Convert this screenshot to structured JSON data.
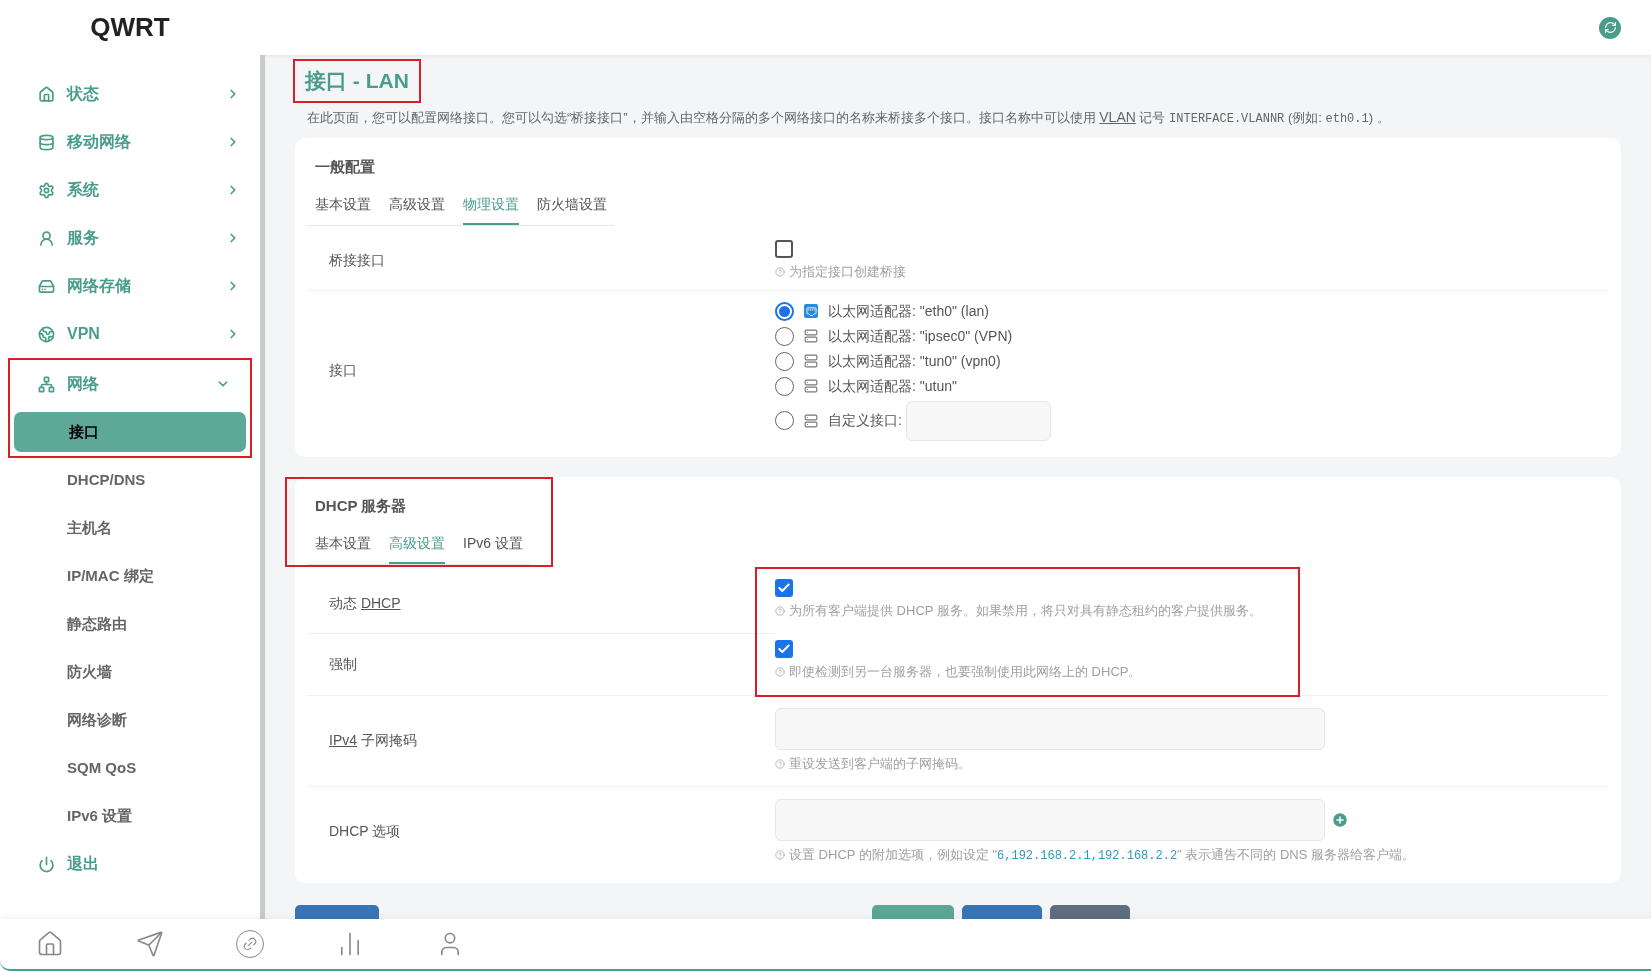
{
  "brand": "QWRT",
  "sidebar": {
    "items": [
      {
        "label": "状态",
        "kind": "group",
        "expanded": false,
        "highlighted": false
      },
      {
        "label": "移动网络",
        "kind": "group",
        "expanded": false,
        "highlighted": false
      },
      {
        "label": "系统",
        "kind": "group",
        "expanded": false,
        "highlighted": false
      },
      {
        "label": "服务",
        "kind": "group",
        "expanded": false,
        "highlighted": false
      },
      {
        "label": "网络存储",
        "kind": "group",
        "expanded": false,
        "highlighted": false
      },
      {
        "label": "VPN",
        "kind": "group",
        "expanded": false,
        "highlighted": false
      },
      {
        "label": "网络",
        "kind": "group",
        "expanded": true,
        "highlighted": true,
        "children": [
          {
            "label": "接口",
            "selected": true
          },
          {
            "label": "DHCP/DNS",
            "selected": false
          },
          {
            "label": "主机名",
            "selected": false
          },
          {
            "label": "IP/MAC 绑定",
            "selected": false
          },
          {
            "label": "静态路由",
            "selected": false
          },
          {
            "label": "防火墙",
            "selected": false
          },
          {
            "label": "网络诊断",
            "selected": false
          },
          {
            "label": "SQM QoS",
            "selected": false
          },
          {
            "label": "IPv6 设置",
            "selected": false
          }
        ]
      },
      {
        "label": "退出",
        "kind": "action"
      }
    ]
  },
  "page": {
    "title": "接口 - LAN",
    "title_highlighted": true,
    "description": [
      {
        "kind": "text",
        "text": "在此页面，您可以配置网络接口。您可以勾选“桥接接口”，并输入由空格分隔的多个网络接口的名称来桥接多个接口。接口名称中可以使用 "
      },
      {
        "kind": "link",
        "text": "VLAN"
      },
      {
        "kind": "text",
        "text": " 记号 "
      },
      {
        "kind": "code",
        "text": "INTERFACE.VLANNR"
      },
      {
        "kind": "text",
        "text": " (例如: "
      },
      {
        "kind": "code",
        "text": "eth0.1"
      },
      {
        "kind": "text",
        "text": ") 。"
      }
    ]
  },
  "general": {
    "heading": "一般配置",
    "tabs": [
      {
        "label": "基本设置",
        "selected": false
      },
      {
        "label": "高级设置",
        "selected": false
      },
      {
        "label": "物理设置",
        "selected": true
      },
      {
        "label": "防火墙设置",
        "selected": false
      }
    ],
    "rows": [
      {
        "kind": "checkbox",
        "label": [
          {
            "text": "桥接接口"
          }
        ],
        "checked": false,
        "hint": [
          {
            "text": "为指定接口创建桥接"
          }
        ]
      },
      {
        "kind": "radios",
        "label": [
          {
            "text": "接口"
          }
        ],
        "options": [
          {
            "kind": "adapter",
            "label": "以太网适配器: \"eth0\" (lan)",
            "selected": true,
            "connected": true
          },
          {
            "kind": "adapter",
            "label": "以太网适配器: \"ipsec0\" (VPN)",
            "selected": false,
            "connected": false
          },
          {
            "kind": "adapter",
            "label": "以太网适配器: \"tun0\" (vpn0)",
            "selected": false,
            "connected": false
          },
          {
            "kind": "adapter",
            "label": "以太网适配器: \"utun\"",
            "selected": false,
            "connected": false
          },
          {
            "kind": "custom",
            "label": "自定义接口:",
            "selected": false,
            "connected": false
          }
        ]
      }
    ]
  },
  "dhcp": {
    "heading": "DHCP 服务器",
    "header_highlighted": true,
    "checks_highlighted": true,
    "tabs": [
      {
        "label": "基本设置",
        "selected": false
      },
      {
        "label": "高级设置",
        "selected": true
      },
      {
        "label": "IPv6 设置",
        "selected": false
      }
    ],
    "rows": [
      {
        "kind": "checkbox",
        "label": [
          {
            "text": "动态 "
          },
          {
            "text": "DHCP",
            "kind": "abbr"
          }
        ],
        "checked": true,
        "hint": [
          {
            "text": "为所有客户端提供 DHCP 服务。如果禁用，将只对具有静态租约的客户提供服务。"
          }
        ]
      },
      {
        "kind": "checkbox",
        "label": [
          {
            "text": "强制"
          }
        ],
        "checked": true,
        "hint": [
          {
            "text": "即使检测到另一台服务器，也要强制使用此网络上的 DHCP。"
          }
        ]
      },
      {
        "kind": "input",
        "label": [
          {
            "text": "IPv4",
            "kind": "abbr"
          },
          {
            "text": " 子网掩码"
          }
        ],
        "addable": false,
        "hint": [
          {
            "text": "重设发送到客户端的子网掩码。"
          }
        ]
      },
      {
        "kind": "input",
        "label": [
          {
            "text": "DHCP 选项"
          }
        ],
        "addable": true,
        "hint": [
          {
            "text": "设置 DHCP 的附加选项，例如设定 \""
          },
          {
            "text": "6,192.168.2.1,192.168.2.2",
            "kind": "code"
          },
          {
            "text": "\" 表示通告不同的 DNS 服务器给客户端。"
          }
        ]
      }
    ]
  },
  "actions": [
    {
      "kind": "back"
    },
    {
      "kind": "apply"
    },
    {
      "kind": "save"
    },
    {
      "kind": "reset"
    }
  ]
}
